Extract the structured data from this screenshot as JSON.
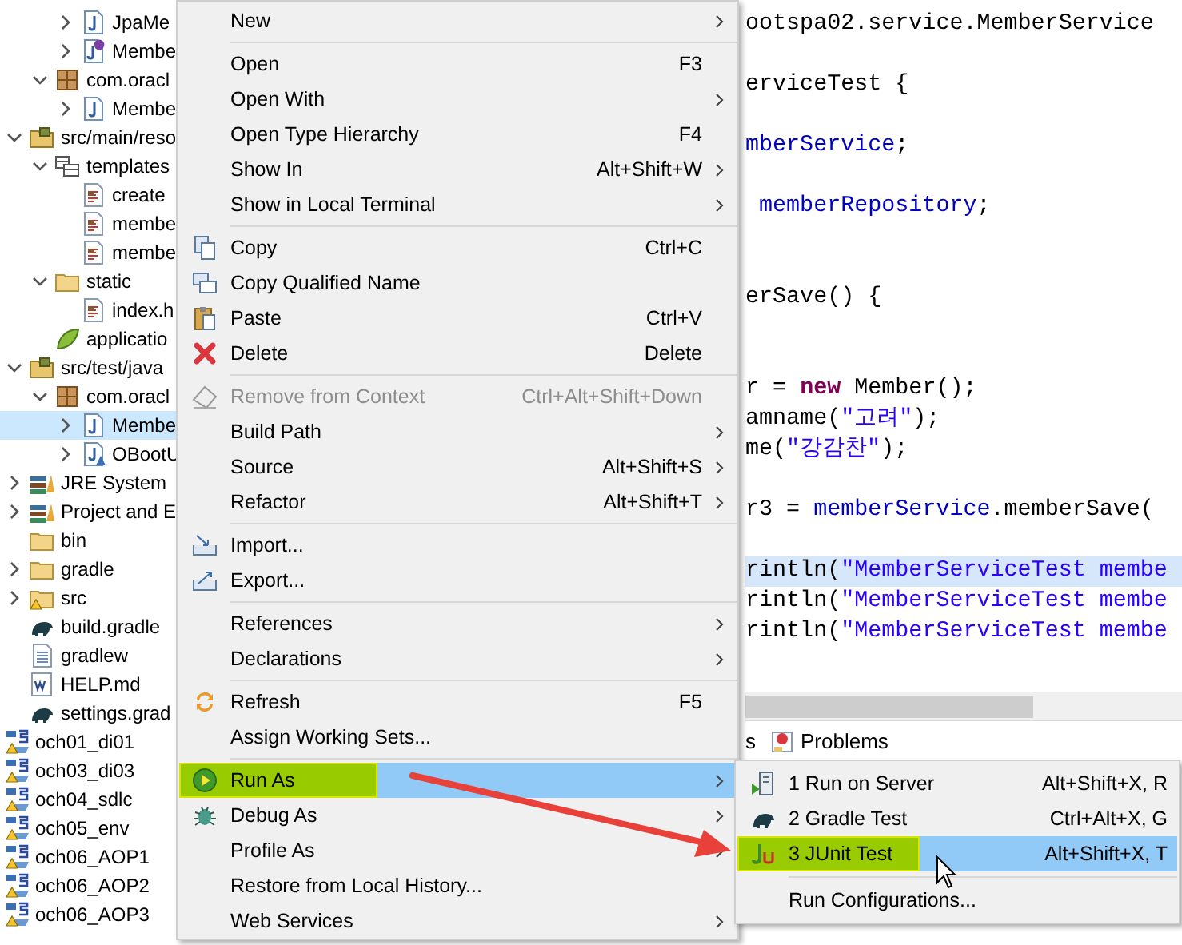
{
  "project_explorer": {
    "tree": [
      {
        "children": [
          {
            "children": [
              {
                "children": [
                  {
                    "label": "JpaMe",
                    "kind": "java-class",
                    "expanded": false,
                    "selected": false
                  },
                  {
                    "label": "Membe",
                    "kind": "interface",
                    "expanded": false,
                    "selected": false
                  }
                ]
              },
              {
                "label": "com.oracl",
                "kind": "package",
                "expanded": true,
                "selected": false,
                "children": [
                  {
                    "label": "Membe",
                    "kind": "java-class",
                    "expanded": false,
                    "selected": false
                  }
                ]
              }
            ]
          },
          {
            "label": "src/main/reso",
            "kind": "source-folder",
            "expanded": true,
            "selected": false,
            "children": [
              {
                "label": "templates",
                "kind": "package-folder",
                "expanded": true,
                "selected": false,
                "children": [
                  {
                    "label": "create",
                    "kind": "html-file",
                    "selected": false
                  },
                  {
                    "label": "membe",
                    "kind": "html-file",
                    "selected": false
                  },
                  {
                    "label": "membe",
                    "kind": "html-file",
                    "selected": false
                  }
                ]
              },
              {
                "label": "static",
                "kind": "folder",
                "expanded": true,
                "selected": false,
                "children": [
                  {
                    "label": "index.h",
                    "kind": "html-file",
                    "selected": false
                  }
                ]
              },
              {
                "label": "applicatio",
                "kind": "properties",
                "selected": false
              }
            ]
          },
          {
            "label": "src/test/java",
            "kind": "source-folder",
            "expanded": true,
            "selected": false,
            "children": [
              {
                "label": "com.oracl",
                "kind": "package",
                "expanded": true,
                "selected": false,
                "children": [
                  {
                    "label": "Membe",
                    "kind": "java-class",
                    "expanded": false,
                    "selected": true
                  },
                  {
                    "label": "OBootU",
                    "kind": "test-class",
                    "expanded": false,
                    "selected": false
                  }
                ]
              }
            ]
          },
          {
            "label": "JRE System",
            "kind": "library",
            "expanded": false,
            "selected": false
          },
          {
            "label": "Project and E",
            "kind": "library",
            "expanded": false,
            "selected": false
          },
          {
            "label": "bin",
            "kind": "folder",
            "selected": false
          },
          {
            "label": "gradle",
            "kind": "folder",
            "expanded": false,
            "selected": false
          },
          {
            "label": "src",
            "kind": "folder",
            "expanded": false,
            "selected": false,
            "warning": true
          },
          {
            "label": "build.gradle",
            "kind": "gradle",
            "selected": false
          },
          {
            "label": "gradlew",
            "kind": "text-file",
            "selected": false
          },
          {
            "label": "HELP.md",
            "kind": "word-file",
            "selected": false
          },
          {
            "label": "settings.grad",
            "kind": "gradle",
            "selected": false
          }
        ]
      },
      {
        "label": "och01_di01",
        "kind": "project",
        "selected": false,
        "warning": true
      },
      {
        "label": "och03_di03",
        "kind": "project",
        "selected": false,
        "warning": true
      },
      {
        "label": "och04_sdlc",
        "kind": "project",
        "selected": false,
        "warning": true
      },
      {
        "label": "och05_env",
        "kind": "project",
        "selected": false,
        "warning": true
      },
      {
        "label": "och06_AOP1",
        "kind": "project",
        "selected": false,
        "warning": true
      },
      {
        "label": "och06_AOP2",
        "kind": "project",
        "selected": false,
        "warning": true
      },
      {
        "label": "och06_AOP3",
        "kind": "project",
        "selected": false,
        "warning": true
      }
    ]
  },
  "editor": {
    "lines": [
      {
        "kind": "code",
        "segments": [
          {
            "kind": "plain",
            "text": "ootspa02.service.MemberService"
          }
        ]
      },
      {
        "kind": "blank"
      },
      {
        "kind": "code",
        "segments": [
          {
            "kind": "plain",
            "text": "erviceTest {"
          }
        ]
      },
      {
        "kind": "blank"
      },
      {
        "kind": "code",
        "segments": [
          {
            "kind": "field",
            "text": "mberService"
          },
          {
            "kind": "plain",
            "text": ";"
          }
        ]
      },
      {
        "kind": "blank"
      },
      {
        "kind": "code",
        "segments": [
          {
            "kind": "field",
            "text": " memberRepository"
          },
          {
            "kind": "plain",
            "text": ";"
          }
        ]
      },
      {
        "kind": "blank"
      },
      {
        "kind": "blank"
      },
      {
        "kind": "code",
        "segments": [
          {
            "kind": "plain",
            "text": "erSave() {"
          }
        ]
      },
      {
        "kind": "blank"
      },
      {
        "kind": "blank"
      },
      {
        "kind": "code",
        "segments": [
          {
            "kind": "plain",
            "text": "r = "
          },
          {
            "kind": "keyword",
            "text": "new"
          },
          {
            "kind": "plain",
            "text": " Member();"
          }
        ]
      },
      {
        "kind": "code",
        "segments": [
          {
            "kind": "plain",
            "text": "amname("
          },
          {
            "kind": "string",
            "text": "\"고려\""
          },
          {
            "kind": "plain",
            "text": ");"
          }
        ]
      },
      {
        "kind": "code",
        "segments": [
          {
            "kind": "plain",
            "text": "me("
          },
          {
            "kind": "string",
            "text": "\"강감찬\""
          },
          {
            "kind": "plain",
            "text": ");"
          }
        ]
      },
      {
        "kind": "blank"
      },
      {
        "kind": "code",
        "segments": [
          {
            "kind": "plain",
            "text": "r3 = "
          },
          {
            "kind": "field",
            "text": "memberService"
          },
          {
            "kind": "plain",
            "text": ".memberSave("
          }
        ]
      },
      {
        "kind": "blank"
      },
      {
        "kind": "code",
        "current": true,
        "segments": [
          {
            "kind": "plain",
            "text": "rintln("
          },
          {
            "kind": "string",
            "text": "\"MemberServiceTest membe"
          }
        ]
      },
      {
        "kind": "code",
        "current": false,
        "segments": [
          {
            "kind": "plain",
            "text": "rintln("
          },
          {
            "kind": "string",
            "text": "\"MemberServiceTest membe"
          }
        ]
      },
      {
        "kind": "code",
        "current": false,
        "segments": [
          {
            "kind": "plain",
            "text": "rintln("
          },
          {
            "kind": "string",
            "text": "\"MemberServiceTest membe"
          }
        ]
      }
    ]
  },
  "bottom_panel": {
    "tabs": [
      {
        "label": "s",
        "kind": "plain",
        "selected": false
      },
      {
        "label": "Problems",
        "kind": "problems",
        "selected": false
      }
    ]
  },
  "context_menu": {
    "items": [
      {
        "kind": "plain",
        "label": "New",
        "submenu": true,
        "disabled": false,
        "active": false,
        "marked": false
      },
      {
        "kind": "separator"
      },
      {
        "kind": "plain",
        "label": "Open",
        "shortcut": "F3",
        "submenu": false,
        "disabled": false,
        "active": false,
        "marked": false
      },
      {
        "kind": "plain",
        "label": "Open With",
        "submenu": true,
        "disabled": false,
        "active": false,
        "marked": false
      },
      {
        "kind": "plain",
        "label": "Open Type Hierarchy",
        "shortcut": "F4",
        "submenu": false,
        "disabled": false,
        "active": false,
        "marked": false
      },
      {
        "kind": "plain",
        "label": "Show In",
        "shortcut": "Alt+Shift+W",
        "submenu": true,
        "disabled": false,
        "active": false,
        "marked": false
      },
      {
        "kind": "plain",
        "label": "Show in Local Terminal",
        "submenu": true,
        "disabled": false,
        "active": false,
        "marked": false
      },
      {
        "kind": "separator"
      },
      {
        "kind": "copy",
        "label": "Copy",
        "shortcut": "Ctrl+C",
        "submenu": false,
        "disabled": false,
        "active": false,
        "marked": false
      },
      {
        "kind": "copy-name",
        "label": "Copy Qualified Name",
        "submenu": false,
        "disabled": false,
        "active": false,
        "marked": false
      },
      {
        "kind": "paste",
        "label": "Paste",
        "shortcut": "Ctrl+V",
        "submenu": false,
        "disabled": false,
        "active": false,
        "marked": false
      },
      {
        "kind": "delete",
        "label": "Delete",
        "shortcut": "Delete",
        "submenu": false,
        "disabled": false,
        "active": false,
        "marked": false
      },
      {
        "kind": "separator"
      },
      {
        "kind": "remove-context",
        "label": "Remove from Context",
        "shortcut": "Ctrl+Alt+Shift+Down",
        "submenu": false,
        "disabled": true,
        "active": false,
        "marked": false
      },
      {
        "kind": "plain",
        "label": "Build Path",
        "submenu": true,
        "disabled": false,
        "active": false,
        "marked": false
      },
      {
        "kind": "plain",
        "label": "Source",
        "shortcut": "Alt+Shift+S",
        "submenu": true,
        "disabled": false,
        "active": false,
        "marked": false
      },
      {
        "kind": "plain",
        "label": "Refactor",
        "shortcut": "Alt+Shift+T",
        "submenu": true,
        "disabled": false,
        "active": false,
        "marked": false
      },
      {
        "kind": "separator"
      },
      {
        "kind": "import",
        "label": "Import...",
        "submenu": false,
        "disabled": false,
        "active": false,
        "marked": false
      },
      {
        "kind": "export",
        "label": "Export...",
        "submenu": false,
        "disabled": false,
        "active": false,
        "marked": false
      },
      {
        "kind": "separator"
      },
      {
        "kind": "plain",
        "label": "References",
        "submenu": true,
        "disabled": false,
        "active": false,
        "marked": false
      },
      {
        "kind": "plain",
        "label": "Declarations",
        "submenu": true,
        "disabled": false,
        "active": false,
        "marked": false
      },
      {
        "kind": "separator"
      },
      {
        "kind": "refresh",
        "label": "Refresh",
        "shortcut": "F5",
        "submenu": false,
        "disabled": false,
        "active": false,
        "marked": false
      },
      {
        "kind": "plain",
        "label": "Assign Working Sets...",
        "submenu": false,
        "disabled": false,
        "active": false,
        "marked": false
      },
      {
        "kind": "separator"
      },
      {
        "kind": "run",
        "label": "Run As",
        "submenu": true,
        "disabled": false,
        "active": true,
        "marked": true
      },
      {
        "kind": "debug",
        "label": "Debug As",
        "submenu": true,
        "disabled": false,
        "active": false,
        "marked": false
      },
      {
        "kind": "plain",
        "label": "Profile As",
        "submenu": true,
        "disabled": false,
        "active": false,
        "marked": false
      },
      {
        "kind": "plain",
        "label": "Restore from Local History...",
        "submenu": false,
        "disabled": false,
        "active": false,
        "marked": false
      },
      {
        "kind": "plain",
        "label": "Web Services",
        "submenu": true,
        "disabled": false,
        "active": false,
        "marked": false
      }
    ]
  },
  "submenu": {
    "items": [
      {
        "kind": "server",
        "label": "1 Run on Server",
        "shortcut": "Alt+Shift+X, R",
        "active": false,
        "marked": false
      },
      {
        "kind": "gradle",
        "label": "2 Gradle Test",
        "shortcut": "Ctrl+Alt+X, G",
        "active": false,
        "marked": false
      },
      {
        "kind": "junit",
        "label": "3 JUnit Test",
        "shortcut": "Alt+Shift+X, T",
        "active": true,
        "marked": true
      },
      {
        "kind": "separator"
      },
      {
        "kind": "plain",
        "label": "Run Configurations...",
        "active": false,
        "marked": false
      }
    ]
  },
  "annotations": [
    {
      "kind": "arrow"
    }
  ]
}
